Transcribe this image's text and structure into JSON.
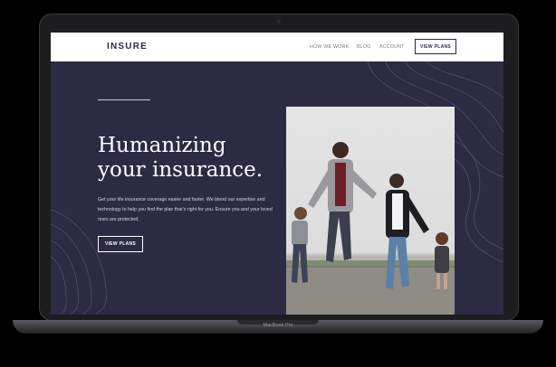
{
  "app": {
    "logo": "INSURE",
    "nav": [
      {
        "label": "HOW WE WORK"
      },
      {
        "label": "BLOG"
      },
      {
        "label": "ACCOUNT"
      }
    ],
    "nav_button": "VIEW PLANS"
  },
  "hero": {
    "title_line1": "Humanizing",
    "title_line2": "your insurance.",
    "paragraph": "Get your life insurance coverage easier and faster. We blend our expertise and technology to help you find the plan that’s right for you. Ensure you and your loved ones are protected.",
    "button": "VIEW PLANS"
  },
  "device": {
    "label": "MacBook Pro"
  },
  "colors": {
    "hero_bg": "#2d2a44",
    "nav_bg": "#ffffff",
    "device_frame": "#1d1d1f"
  }
}
